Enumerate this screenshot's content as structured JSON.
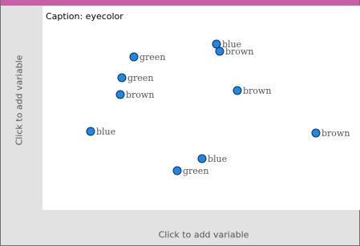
{
  "caption": "Caption: eyecolor",
  "y_axis_hint": "Click to add variable",
  "x_axis_hint": "Click to add variable",
  "colors": {
    "accent_bar": "#c75ea6",
    "dot_fill": "#1e88e5",
    "dot_stroke": "#0b2e6b"
  },
  "points": [
    {
      "label": "blue"
    },
    {
      "label": "brown"
    },
    {
      "label": "green"
    },
    {
      "label": "green"
    },
    {
      "label": "brown"
    },
    {
      "label": "brown"
    },
    {
      "label": "blue"
    },
    {
      "label": "brown"
    },
    {
      "label": "blue"
    },
    {
      "label": "green"
    }
  ]
}
